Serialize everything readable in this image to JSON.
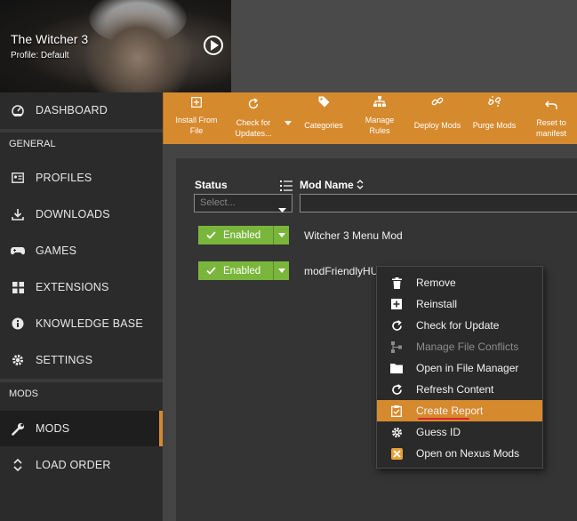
{
  "game": {
    "title": "The Witcher 3",
    "profile": "Profile: Default"
  },
  "sidebar": {
    "dashboard": "DASHBOARD",
    "general_label": "GENERAL",
    "profiles": "PROFILES",
    "downloads": "DOWNLOADS",
    "games": "GAMES",
    "extensions": "EXTENSIONS",
    "knowledge_base": "KNOWLEDGE BASE",
    "settings": "SETTINGS",
    "mods_label": "MODS",
    "mods": "MODS",
    "load_order": "LOAD ORDER"
  },
  "toolbar": {
    "install_from_file_1": "Install From",
    "install_from_file_2": "File",
    "check_updates_1": "Check for",
    "check_updates_2": "Updates...",
    "categories": "Categories",
    "manage_rules_1": "Manage",
    "manage_rules_2": "Rules",
    "deploy_mods": "Deploy Mods",
    "purge_mods": "Purge Mods",
    "reset_manifest_1": "Reset to",
    "reset_manifest_2": "manifest"
  },
  "table": {
    "col_status": "Status",
    "col_mod_name": "Mod Name",
    "status_placeholder": "Select...",
    "rows": [
      {
        "status": "Enabled",
        "name": "Witcher 3 Menu Mod"
      },
      {
        "status": "Enabled",
        "name": "modFriendlyHU"
      }
    ]
  },
  "context_menu": {
    "items": [
      {
        "label": "Remove",
        "icon": "trash-icon"
      },
      {
        "label": "Reinstall",
        "icon": "plus-box-icon"
      },
      {
        "label": "Check for Update",
        "icon": "refresh-icon"
      },
      {
        "label": "Manage File Conflicts",
        "icon": "conflict-icon"
      },
      {
        "label": "Open in File Manager",
        "icon": "folder-icon"
      },
      {
        "label": "Refresh Content",
        "icon": "refresh-icon"
      },
      {
        "label": "Create Report",
        "icon": "report-icon"
      },
      {
        "label": "Guess ID",
        "icon": "gear-icon"
      },
      {
        "label": "Open on Nexus Mods",
        "icon": "nexus-icon"
      }
    ]
  },
  "colors": {
    "accent": "#d68a2e",
    "enabled": "#79b63b",
    "sidebar": "#2b2b2b",
    "underline": "#e0242b"
  }
}
